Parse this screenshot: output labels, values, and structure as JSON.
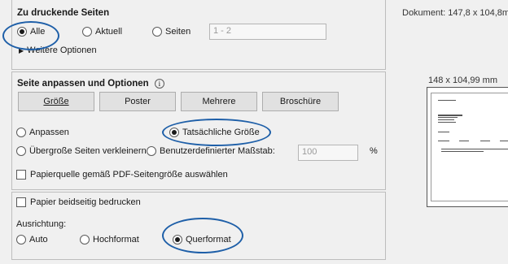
{
  "pages_group": {
    "title": "Zu druckende Seiten",
    "radio_all": "Alle",
    "radio_current": "Aktuell",
    "radio_pages": "Seiten",
    "pages_value": "1 - 2",
    "more_options": "Weitere Optionen"
  },
  "fit_group": {
    "title": "Seite anpassen und Optionen",
    "info_icon": "i",
    "buttons": [
      "Größe",
      "Poster",
      "Mehrere",
      "Broschüre"
    ],
    "radio_fit": "Anpassen",
    "radio_actual_size": "Tatsächliche Größe",
    "radio_shrink": "Übergroße Seiten verkleinern",
    "radio_custom": "Benutzerdefinierter Maßstab:",
    "scale_value": "100",
    "scale_unit": "%",
    "checkbox_paper_source": "Papierquelle gemäß PDF-Seitengröße auswählen"
  },
  "duplex_group": {
    "checkbox_duplex": "Papier beidseitig bedrucken",
    "orientation_label": "Ausrichtung:",
    "radio_auto": "Auto",
    "radio_portrait": "Hochformat",
    "radio_landscape": "Querformat"
  },
  "preview": {
    "document_label": "Dokument: 147,8 x 104,8m",
    "size_label": "148 x 104,99 mm"
  },
  "colors": {
    "highlight_ellipse": "#1e5fa8"
  }
}
